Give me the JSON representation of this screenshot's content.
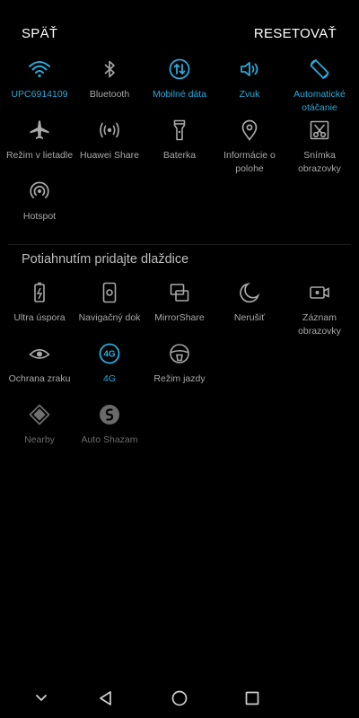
{
  "header": {
    "back_label": "SPÄŤ",
    "reset_label": "RESETOVAŤ"
  },
  "active_tiles": [
    {
      "label": "UPC6914109",
      "icon": "wifi-icon",
      "active": true
    },
    {
      "label": "Bluetooth",
      "icon": "bluetooth-icon",
      "active": false
    },
    {
      "label": "Mobilné dáta",
      "icon": "mobile-data-icon",
      "active": true
    },
    {
      "label": "Zvuk",
      "icon": "speaker-icon",
      "active": true
    },
    {
      "label": "Automatické otáčanie",
      "icon": "auto-rotate-icon",
      "active": true
    },
    {
      "label": "Režim v lietadle",
      "icon": "airplane-icon",
      "active": false
    },
    {
      "label": "Huawei Share",
      "icon": "huawei-share-icon",
      "active": false
    },
    {
      "label": "Baterka",
      "icon": "flashlight-icon",
      "active": false
    },
    {
      "label": "Informácie o polohe",
      "icon": "location-pin-icon",
      "active": false
    },
    {
      "label": "Snímka obrazovky",
      "icon": "screenshot-icon",
      "active": false
    },
    {
      "label": "Hotspot",
      "icon": "hotspot-icon",
      "active": false
    }
  ],
  "add_section": {
    "title": "Potiahnutím pridajte dlaždice",
    "tiles": [
      {
        "label": "Ultra úspora",
        "icon": "battery-saver-icon",
        "active": false
      },
      {
        "label": "Navigačný dok",
        "icon": "navigation-dock-icon",
        "active": false
      },
      {
        "label": "MirrorShare",
        "icon": "mirrorshare-icon",
        "active": false
      },
      {
        "label": "Nerušiť",
        "icon": "moon-icon",
        "active": false
      },
      {
        "label": "Záznam obrazovky",
        "icon": "screen-record-icon",
        "active": false
      },
      {
        "label": "Ochrana zraku",
        "icon": "eye-icon",
        "active": false
      },
      {
        "label": "4G",
        "icon": "4g-icon",
        "active": true
      },
      {
        "label": "Režim jazdy",
        "icon": "driving-mode-icon",
        "active": false
      },
      {
        "label": "Nearby",
        "icon": "nearby-icon",
        "active": false,
        "disabled": true
      },
      {
        "label": "Auto Shazam",
        "icon": "shazam-icon",
        "active": false,
        "disabled": true
      }
    ]
  },
  "navbar": {
    "items": [
      "collapse-icon",
      "back-icon",
      "home-icon",
      "recents-icon"
    ]
  },
  "colors": {
    "accent": "#2aa9d8",
    "text": "#a8a8a8",
    "disabled": "#6a6a6a",
    "background": "#000000"
  }
}
